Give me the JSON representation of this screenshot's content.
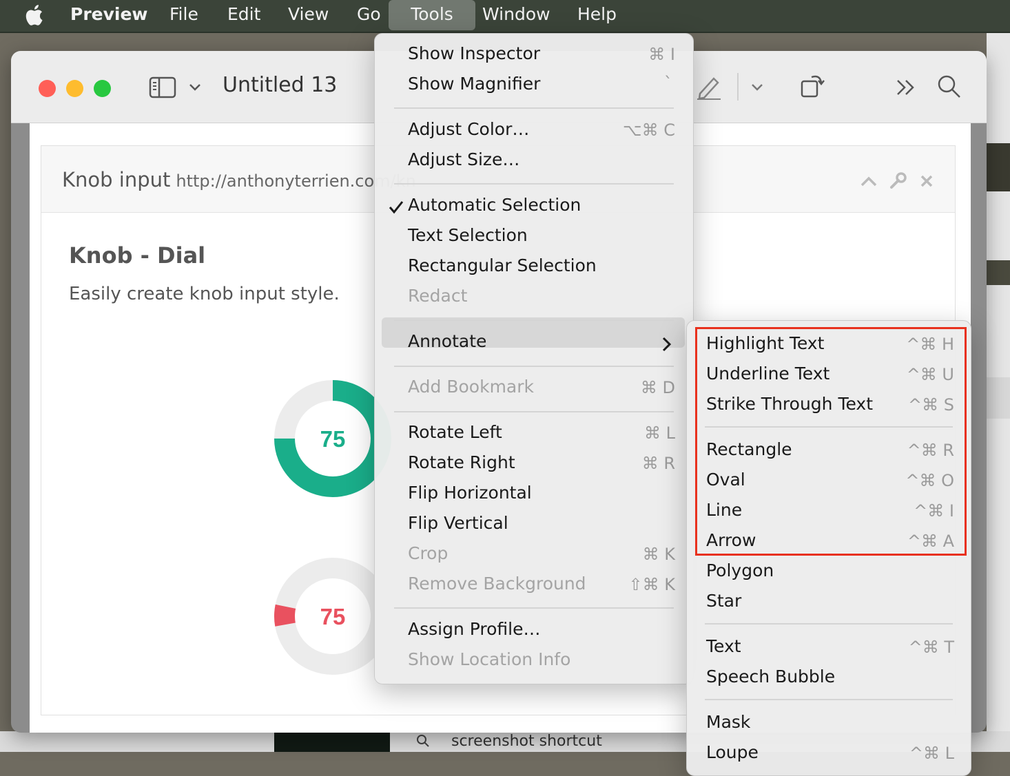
{
  "menubar": {
    "app": "Preview",
    "items": [
      "File",
      "Edit",
      "View",
      "Go",
      "Tools",
      "Window",
      "Help"
    ],
    "active": "Tools"
  },
  "window": {
    "title": "Untitled 13",
    "traffic_colors": [
      "#ff5f57",
      "#febc2e",
      "#28c840"
    ]
  },
  "document": {
    "panel_title": "Knob input",
    "panel_url": "http://anthonyterrien.com/kn",
    "heading": "Knob - Dial",
    "description": "Easily create knob input style.",
    "knob1": {
      "value": "75",
      "fraction": 0.75,
      "color": "#1aae8a"
    },
    "knob2": {
      "value": "75",
      "fraction": 0.06,
      "color": "#e9515f"
    }
  },
  "tools_menu": [
    {
      "label": "Show Inspector",
      "shortcut": "⌘ I",
      "disabled": false
    },
    {
      "label": "Show Magnifier",
      "shortcut": "`",
      "disabled": false
    },
    {
      "label": "Adjust Color…",
      "shortcut": "⌥⌘ C",
      "disabled": false
    },
    {
      "label": "Adjust Size…",
      "shortcut": "",
      "disabled": false
    },
    {
      "label": "Automatic Selection",
      "shortcut": "",
      "disabled": false,
      "checked": true
    },
    {
      "label": "Text Selection",
      "shortcut": "",
      "disabled": false
    },
    {
      "label": "Rectangular Selection",
      "shortcut": "",
      "disabled": false
    },
    {
      "label": "Redact",
      "shortcut": "",
      "disabled": true
    },
    {
      "label": "Annotate",
      "shortcut": "",
      "disabled": false,
      "submenu": true
    },
    {
      "label": "Add Bookmark",
      "shortcut": "⌘ D",
      "disabled": true
    },
    {
      "label": "Rotate Left",
      "shortcut": "⌘ L",
      "disabled": false
    },
    {
      "label": "Rotate Right",
      "shortcut": "⌘ R",
      "disabled": false
    },
    {
      "label": "Flip Horizontal",
      "shortcut": "",
      "disabled": false
    },
    {
      "label": "Flip Vertical",
      "shortcut": "",
      "disabled": false
    },
    {
      "label": "Crop",
      "shortcut": "⌘ K",
      "disabled": true
    },
    {
      "label": "Remove Background",
      "shortcut": "⇧⌘ K",
      "disabled": true
    },
    {
      "label": "Assign Profile…",
      "shortcut": "",
      "disabled": false
    },
    {
      "label": "Show Location Info",
      "shortcut": "",
      "disabled": true
    }
  ],
  "annotate_menu": [
    {
      "label": "Highlight Text",
      "shortcut": "^⌘ H"
    },
    {
      "label": "Underline Text",
      "shortcut": "^⌘ U"
    },
    {
      "label": "Strike Through Text",
      "shortcut": "^⌘ S"
    },
    {
      "label": "Rectangle",
      "shortcut": "^⌘ R"
    },
    {
      "label": "Oval",
      "shortcut": "^⌘ O"
    },
    {
      "label": "Line",
      "shortcut": "^⌘ I"
    },
    {
      "label": "Arrow",
      "shortcut": "^⌘ A"
    },
    {
      "label": "Polygon",
      "shortcut": ""
    },
    {
      "label": "Star",
      "shortcut": ""
    },
    {
      "label": "Text",
      "shortcut": "^⌘ T"
    },
    {
      "label": "Speech Bubble",
      "shortcut": ""
    },
    {
      "label": "Mask",
      "shortcut": ""
    },
    {
      "label": "Loupe",
      "shortcut": "^⌘ L"
    }
  ],
  "background": {
    "search_result": "screenshot shortcut"
  }
}
